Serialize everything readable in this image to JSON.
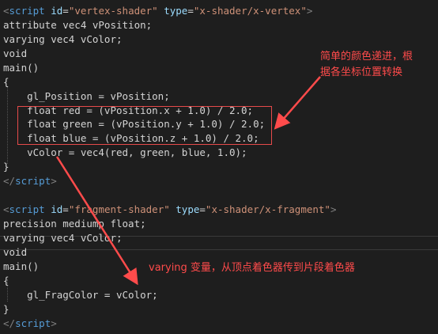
{
  "code": {
    "l1": {
      "lt": "<",
      "tag": "script",
      "sp1": " ",
      "a1": "id",
      "eq1": "=",
      "v1": "\"vertex-shader\"",
      "sp2": " ",
      "a2": "type",
      "eq2": "=",
      "v2": "\"x-shader/x-vertex\"",
      "gt": ">"
    },
    "l2": "attribute vec4 vPosition;",
    "l3": "varying vec4 vColor;",
    "l4": "void",
    "l5": "main()",
    "l6": "{",
    "l7": "    gl_Position = vPosition;",
    "l8": "    float red = (vPosition.x + 1.0) / 2.0;",
    "l9": "    float green = (vPosition.y + 1.0) / 2.0;",
    "l10": "    float blue = (vPosition.z + 1.0) / 2.0;",
    "l11": "    vColor = vec4(red, green, blue, 1.0);",
    "l12": "}",
    "l13": {
      "open": "</",
      "tag": "script",
      "close": ">"
    },
    "l15": {
      "lt": "<",
      "tag": "script",
      "sp1": " ",
      "a1": "id",
      "eq1": "=",
      "v1": "\"fragment-shader\"",
      "sp2": " ",
      "a2": "type",
      "eq2": "=",
      "v2": "\"x-shader/x-fragment\"",
      "gt": ">"
    },
    "l16": "precision mediump float;",
    "l17": "varying vec4 vColor;",
    "l18": "void",
    "l19": "main()",
    "l20": "{",
    "l21": "    gl_FragColor = vColor;",
    "l22": "}",
    "l23": {
      "open": "</",
      "tag": "script",
      "close": ">"
    }
  },
  "annotations": {
    "note1_line1": "简单的颜色递进，根",
    "note1_line2": "据各坐标位置转换",
    "note2": "varying 变量，从顶点着色器传到片段着色器"
  },
  "colors": {
    "background": "#1e1e1e",
    "annotation": "#ff4b4b",
    "tag_name": "#569cd6",
    "attr_name": "#9cdcfe",
    "attr_value": "#ce9178"
  }
}
